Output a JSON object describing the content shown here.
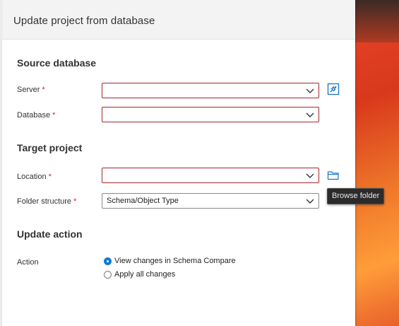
{
  "dialog": {
    "title": "Update project from database"
  },
  "source_database": {
    "heading": "Source database",
    "server": {
      "label": "Server",
      "required_mark": "*",
      "value": ""
    },
    "database": {
      "label": "Database",
      "required_mark": "*",
      "value": ""
    },
    "connect_icon": "plug-connect-icon"
  },
  "target_project": {
    "heading": "Target project",
    "location": {
      "label": "Location",
      "required_mark": "*",
      "value": ""
    },
    "folder_structure": {
      "label": "Folder structure",
      "required_mark": "*",
      "value": "Schema/Object Type"
    },
    "browse_icon": "folder-icon",
    "browse_tooltip": "Browse folder"
  },
  "update_action": {
    "heading": "Update action",
    "action_label": "Action",
    "options": [
      {
        "label": "View changes in Schema Compare",
        "selected": true
      },
      {
        "label": "Apply all changes",
        "selected": false
      }
    ]
  },
  "colors": {
    "accent": "#0e7cd1",
    "required": "#c42b1c",
    "invalid_border": "#a4262c",
    "tooltip_bg": "#2b2b2b"
  }
}
